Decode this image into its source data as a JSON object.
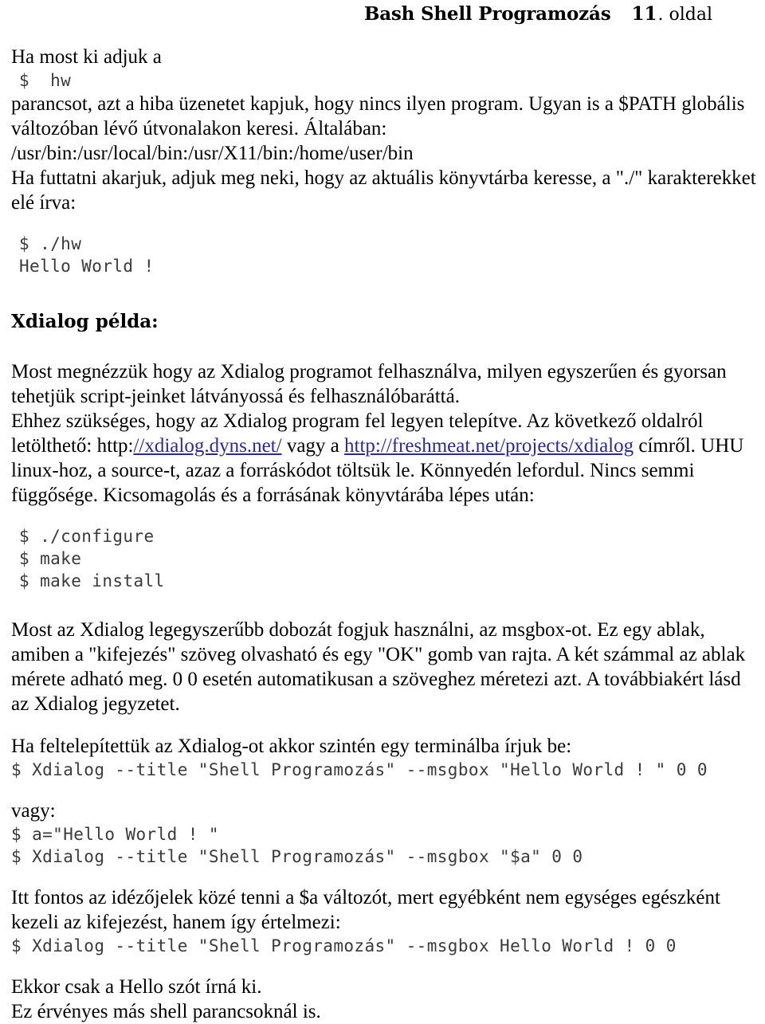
{
  "header": {
    "title": "Bash Shell Programozás",
    "page_number": "11",
    "page_label": ". oldal"
  },
  "sections": {
    "intro": {
      "line1": "Ha most ki adjuk a",
      "code1": "$  hw",
      "para1": "parancsot, azt a hiba üzenetet kapjuk, hogy nincs ilyen program. Ugyan is a $PATH globális változóban lévő útvonalakon keresi. Általában:",
      "path_line": "/usr/bin:/usr/local/bin:/usr/X11/bin:/home/user/bin",
      "para2": "Ha futtatni akarjuk, adjuk meg neki, hogy az aktuális könyvtárba keresse, a \"./\" karakterekket elé írva:",
      "code2": "$ ./hw\nHello World !"
    },
    "xdialog": {
      "heading": "Xdialog példa:",
      "para1_part1": "Most megnézzük hogy az Xdialog programot felhasználva, milyen egyszerűen és gyorsan tehetjük script-jeinket látványossá és felhasználóbaráttá.",
      "para1_part2": "Ehhez szükséges, hogy az Xdialog program fel legyen telepítve. Az következő oldalról letölthető: http:",
      "link1_text": "//xdialog.dyns.net/",
      "between_links": " vagy a ",
      "link2_text": "http://freshmeat.net/projects/xdialog",
      "para1_part3": " címről. UHU linux-hoz, a source-t, azaz a forráskódot töltsük le. Könnyedén lefordul. Nincs semmi függősége. Kicsomagolás és a forrásának könyvtárába lépes után:",
      "build_code": "$ ./configure\n$ make\n$ make install",
      "para2": "Most az Xdialog legegyszerűbb dobozát fogjuk használni, az msgbox-ot. Ez egy ablak, amiben a \"kifejezés\" szöveg olvasható és egy \"OK\" gomb van rajta. A két számmal az ablak mérete adható meg. 0 0 esetén automatikusan a szöveghez méretezi azt. A továbbiakért lásd az Xdialog jegyzetet.",
      "para3": "Ha feltelepítettük az Xdialog-ot akkor szintén egy terminálba írjuk be:",
      "code_msgbox1": "$ Xdialog --title \"Shell Programozás\" --msgbox \"Hello World ! \" 0 0",
      "vagy_label": "vagy:",
      "code_msgbox2": "$ a=\"Hello World ! \"\n$ Xdialog --title \"Shell Programozás\" --msgbox \"$a\" 0 0",
      "para4": "Itt fontos az idézőjelek közé tenni a $a változót, mert egyébként nem egységes egészként kezeli az kifejezést, hanem így értelmezi:",
      "code_msgbox3": "$ Xdialog --title \"Shell Programozás\" --msgbox Hello World ! 0 0",
      "closing_line1": "Ekkor csak a Hello szót írná ki.",
      "closing_line2": "Ez érvényes más shell parancsoknál is."
    }
  },
  "colors": {
    "text": "#000000",
    "code": "#3a3a3a",
    "link": "#2b2b8f",
    "background": "#ffffff"
  }
}
